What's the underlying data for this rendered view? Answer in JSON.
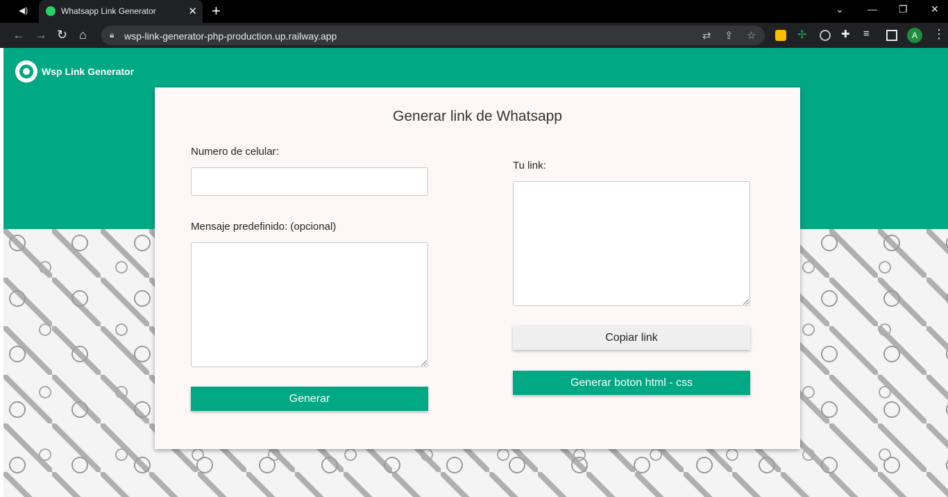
{
  "browser": {
    "tab_title": "Whatsapp Link Generator",
    "url": "wsp-link-generator-php-production.up.railway.app",
    "profile_initial": "A"
  },
  "icons": {
    "speaker": "speaker-icon",
    "back": "back-arrow-icon",
    "forward": "forward-arrow-icon",
    "reload": "reload-icon",
    "home": "home-icon",
    "lock": "lock-icon",
    "translate": "translate-icon",
    "share": "share-icon",
    "star": "star-icon",
    "extensions": "puzzle-icon",
    "menu": "kebab-menu-icon"
  },
  "colors": {
    "brand_green": "#00a884",
    "card_bg": "#fdf8f7"
  },
  "header": {
    "brand_name": "Wsp Link Generator"
  },
  "form": {
    "title": "Generar link de Whatsapp",
    "phone_label": "Numero de celular:",
    "phone_value": "",
    "message_label": "Mensaje predefinido: (opcional)",
    "message_value": "",
    "generate_button": "Generar",
    "link_label": "Tu link:",
    "link_value": "",
    "copy_button": "Copiar link",
    "generate_html_button": "Generar boton html - css"
  }
}
